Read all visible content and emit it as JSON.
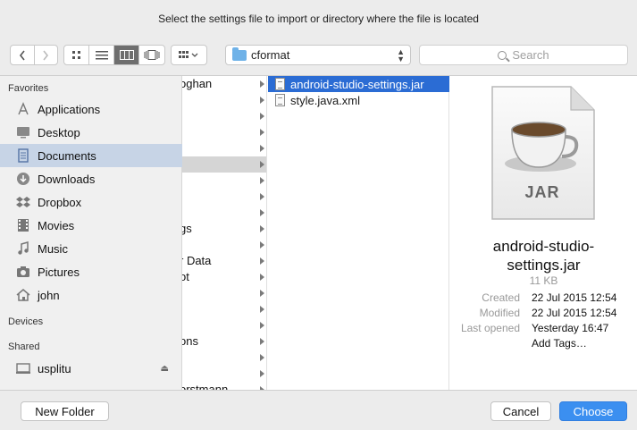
{
  "dialog": {
    "title": "Select the settings file to import or directory where the file is located"
  },
  "toolbar": {
    "back_icon": "chevron-left-icon",
    "forward_icon": "chevron-right-icon",
    "path": "cformat",
    "search_placeholder": "Search"
  },
  "sidebar": {
    "favorites_title": "Favorites",
    "favorites": [
      {
        "label": "Applications",
        "icon": "applications-icon"
      },
      {
        "label": "Desktop",
        "icon": "desktop-icon"
      },
      {
        "label": "Documents",
        "icon": "documents-icon",
        "selected": true
      },
      {
        "label": "Downloads",
        "icon": "downloads-icon"
      },
      {
        "label": "Dropbox",
        "icon": "dropbox-icon"
      },
      {
        "label": "Movies",
        "icon": "movies-icon"
      },
      {
        "label": "Music",
        "icon": "music-icon"
      },
      {
        "label": "Pictures",
        "icon": "pictures-icon"
      },
      {
        "label": "john",
        "icon": "home-icon"
      }
    ],
    "devices_title": "Devices",
    "shared_title": "Shared",
    "shared": [
      {
        "label": "usplitu",
        "icon": "computer-icon"
      }
    ]
  },
  "column1": [
    {
      "text": "oghan"
    },
    {
      "text": ""
    },
    {
      "text": ""
    },
    {
      "text": ""
    },
    {
      "text": ""
    },
    {
      "text": "",
      "highlighted": true
    },
    {
      "text": ""
    },
    {
      "text": ""
    },
    {
      "text": ""
    },
    {
      "text": "gs"
    },
    {
      "text": ""
    },
    {
      "text": "r Data"
    },
    {
      "text": "ot"
    },
    {
      "text": ""
    },
    {
      "text": ""
    },
    {
      "text": ""
    },
    {
      "text": "ons"
    },
    {
      "text": ""
    },
    {
      "text": ""
    },
    {
      "text": "orstmann"
    }
  ],
  "column2": [
    {
      "name": "android-studio-settings.jar",
      "selected": true
    },
    {
      "name": "style.java.xml"
    }
  ],
  "preview": {
    "jar_label": "JAR",
    "name_line1": "android-studio-",
    "name_line2": "settings.jar",
    "size": "11 KB",
    "created_label": "Created",
    "created_value": "22 Jul 2015 12:54",
    "modified_label": "Modified",
    "modified_value": "22 Jul 2015 12:54",
    "last_opened_label": "Last opened",
    "last_opened_value": "Yesterday 16:47",
    "add_tags": "Add Tags…"
  },
  "footer": {
    "new_folder": "New Folder",
    "cancel": "Cancel",
    "choose": "Choose"
  },
  "colors": {
    "accent": "#2b6cd4",
    "primary_button": "#3b8ff0",
    "sidebar_selected": "#c7d4e6"
  }
}
